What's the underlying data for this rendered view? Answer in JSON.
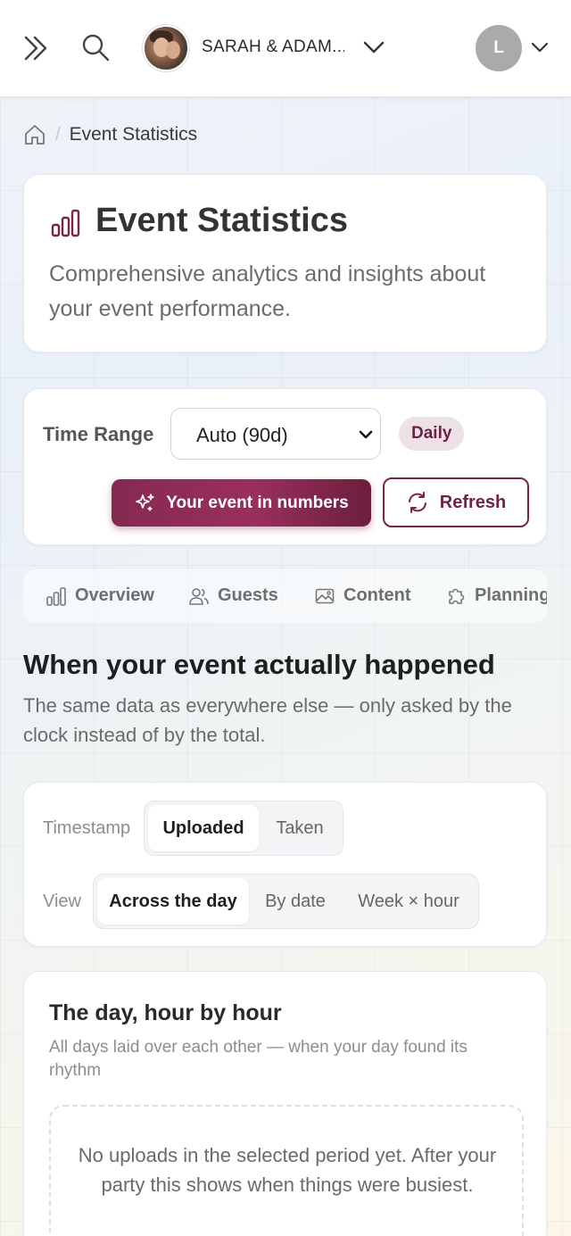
{
  "topbar": {
    "event_name": "SARAH & ADAM...",
    "user_initial": "L",
    "icons": [
      "expand-icon",
      "search-icon",
      "chevron-down-icon"
    ]
  },
  "breadcrumb": {
    "current": "Event Statistics",
    "separator": "/"
  },
  "header": {
    "title": "Event Statistics",
    "subtitle": "Comprehensive analytics and insights about your event performance."
  },
  "controls": {
    "time_range_label": "Time Range",
    "time_range_value": "Auto (90d)",
    "granularity_badge": "Daily",
    "numbers_button": "Your event in numbers",
    "refresh_button": "Refresh"
  },
  "tabs": [
    {
      "label": "Overview"
    },
    {
      "label": "Guests"
    },
    {
      "label": "Content"
    },
    {
      "label": "Planning"
    }
  ],
  "section": {
    "title": "When your event actually happened",
    "subtitle": "The same data as everywhere else — only asked by the clock instead of by the total."
  },
  "filters": {
    "timestamp_label": "Timestamp",
    "timestamp_options": [
      "Uploaded",
      "Taken"
    ],
    "timestamp_selected": "Uploaded",
    "view_label": "View",
    "view_options": [
      "Across the day",
      "By date",
      "Week × hour"
    ],
    "view_selected": "Across the day"
  },
  "chart_card": {
    "title": "The day, hour by hour",
    "subtitle": "All days laid over each other — when your day found its rhythm",
    "empty_message": "No uploads in the selected period yet. After your party this shows when things were busiest."
  },
  "colors": {
    "brand": "#7a2548",
    "badge_bg": "#ece1e6",
    "avatar_bg": "#aaaaaa"
  }
}
